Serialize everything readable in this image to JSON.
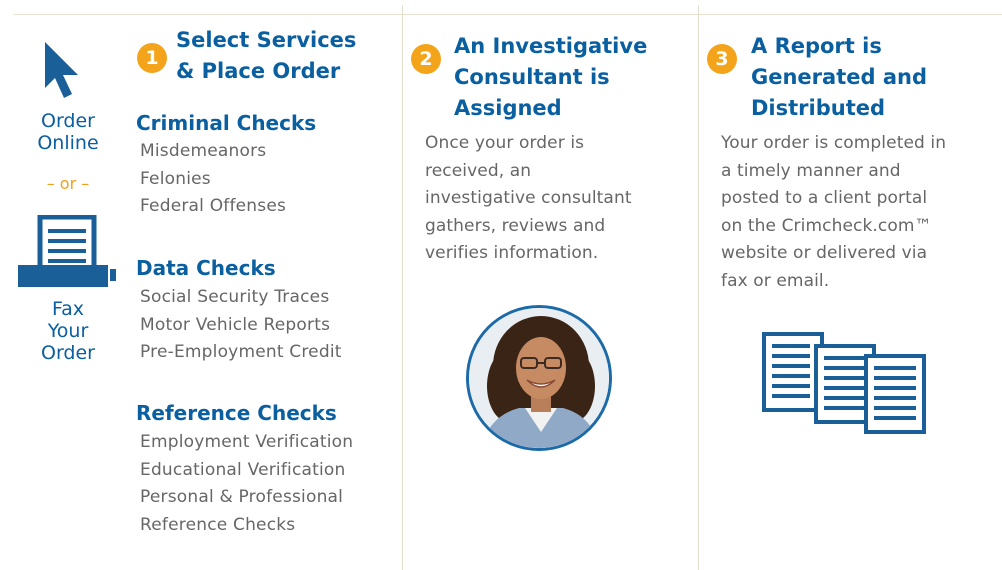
{
  "left": {
    "order_online": [
      "Order",
      "Online"
    ],
    "or": "– or –",
    "fax": [
      "Fax",
      "Your",
      "Order"
    ]
  },
  "step1": {
    "number": "1",
    "title": [
      "Select Services",
      "& Place Order"
    ],
    "sections": [
      {
        "title": "Criminal Checks",
        "items": [
          "Misdemeanors",
          "Felonies",
          "Federal Offenses"
        ]
      },
      {
        "title": "Data Checks",
        "items": [
          "Social Security Traces",
          "Motor Vehicle Reports",
          "Pre-Employment Credit"
        ]
      },
      {
        "title": "Reference Checks",
        "items": [
          "Employment Verification",
          "Educational Verification",
          "Personal & Professional",
          "Reference Checks"
        ]
      }
    ]
  },
  "step2": {
    "number": "2",
    "title": [
      "An Investigative",
      "Consultant is",
      "Assigned"
    ],
    "body": [
      "Once your order is",
      "received, an",
      "investigative consultant",
      "gathers, reviews and",
      "verifies information."
    ]
  },
  "step3": {
    "number": "3",
    "title": [
      "A Report is",
      "Generated and",
      "Distributed"
    ],
    "body": [
      "Your order is completed in",
      "a timely manner and",
      "posted to a client portal",
      "on the Crimcheck.com™",
      "website or delivered via",
      "fax or email."
    ]
  },
  "icons": {
    "cursor": "cursor-arrow-icon",
    "fax": "fax-machine-icon",
    "documents": "documents-icon",
    "accent": "#0a5fa0",
    "orange": "#f3a41b"
  }
}
